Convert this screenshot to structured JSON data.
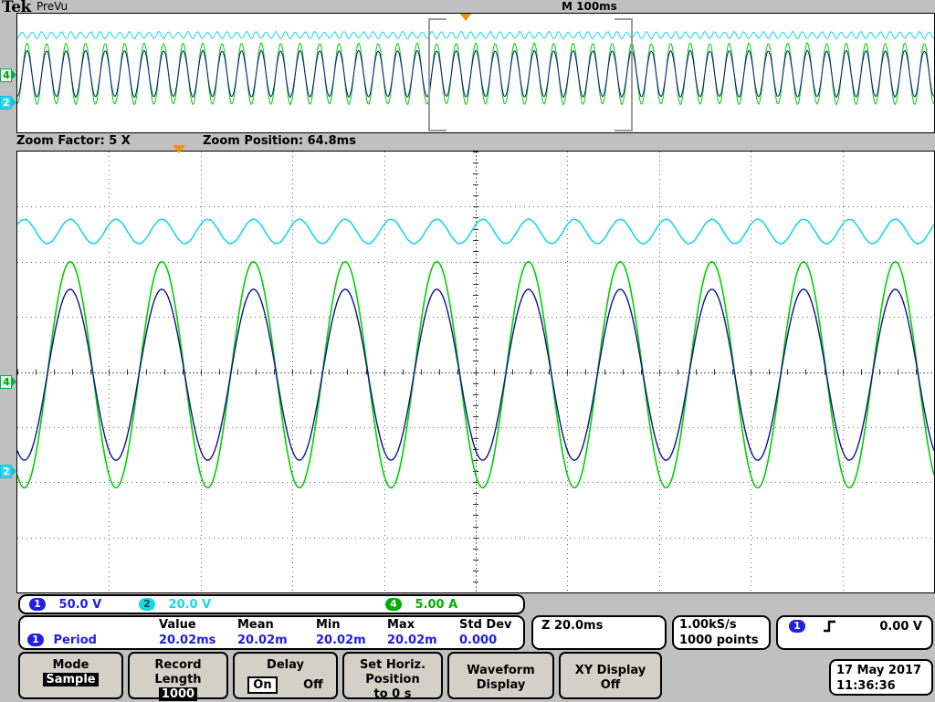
{
  "header": {
    "brand": "Tek",
    "acq_state": "PreVu",
    "horizontal_scale": "M 100ms"
  },
  "zoom_bar": {
    "factor_label": "Zoom Factor: 5 X",
    "position_label": "Zoom Position: 64.8ms"
  },
  "channels": [
    {
      "num": "1",
      "scale": "50.0 V",
      "color": "#2020e0"
    },
    {
      "num": "2",
      "scale": "20.0 V",
      "color": "#18d8e8"
    },
    {
      "num": "4",
      "scale": "5.00 A",
      "color": "#00b000"
    }
  ],
  "measurement": {
    "source_badge": "1",
    "name": "Period",
    "columns": [
      "Value",
      "Mean",
      "Min",
      "Max",
      "Std Dev"
    ],
    "values": [
      "20.02ms",
      "20.02m",
      "20.02m",
      "20.02m",
      "0.000"
    ]
  },
  "zoom_timebase": "Z 20.0ms",
  "acquisition": {
    "sample_rate": "1.00kS/s",
    "record_points": "1000 points"
  },
  "trigger": {
    "source_badge": "1",
    "slope_icon": "rising-edge-icon",
    "level": "0.00 V"
  },
  "menu_buttons": [
    {
      "name": "mode",
      "line1": "Mode",
      "line2": "Sample",
      "line2_style": "inverse"
    },
    {
      "name": "record-length",
      "line1": "Record",
      "line2": "Length",
      "line3": "1000",
      "line3_style": "inverse"
    },
    {
      "name": "delay",
      "line1": "Delay",
      "opt_on": "On",
      "opt_off": "Off",
      "selected": "On"
    },
    {
      "name": "set-horiz-position",
      "line1": "Set Horiz.",
      "line2": "Position",
      "line3": "to 0 s"
    },
    {
      "name": "waveform-display",
      "line1": "Waveform",
      "line2": "Display"
    },
    {
      "name": "xy-display",
      "line1": "XY Display",
      "line2": "Off"
    }
  ],
  "clock": {
    "date": "17 May 2017",
    "time": "11:36:36"
  },
  "markers": {
    "overview_ch4": "4",
    "overview_ch2": "2",
    "zoom_ch4": "4",
    "zoom_ch2": "2"
  },
  "chart_data": {
    "type": "line",
    "title": "Oscilloscope waveform display",
    "overview": {
      "timebase_per_div": "100ms",
      "x_divisions": 10,
      "y_divisions": 8,
      "series": [
        {
          "name": "CH2",
          "color": "#18d8e8",
          "waveform": "sine",
          "frequency_hz": 50,
          "amplitude_div": 0.22,
          "offset_div": 2.55,
          "scale": "20.0 V"
        },
        {
          "name": "CH4",
          "color": "#00d000",
          "waveform": "sine",
          "frequency_hz": 50,
          "amplitude_div": 2.05,
          "offset_div": -0.05,
          "scale": "5.00 A"
        },
        {
          "name": "CH1",
          "color": "#101090",
          "waveform": "sine",
          "frequency_hz": 50,
          "amplitude_div": 1.55,
          "offset_div": -0.05,
          "scale": "50.0 V"
        }
      ]
    },
    "zoom": {
      "timebase_per_div": "20.0ms",
      "zoom_factor": "5 X",
      "zoom_position_ms": 64.8,
      "x_divisions": 10,
      "y_divisions": 8,
      "cycles_visible": 10,
      "series": [
        {
          "name": "CH2",
          "color": "#18d8e8",
          "waveform": "sine",
          "frequency_hz": 50,
          "amplitude_div": 0.22,
          "offset_div": 2.55,
          "scale": "20.0 V"
        },
        {
          "name": "CH4",
          "color": "#00d000",
          "waveform": "sine",
          "frequency_hz": 50,
          "amplitude_div": 2.05,
          "offset_div": -0.05,
          "scale": "5.00 A"
        },
        {
          "name": "CH1",
          "color": "#101090",
          "waveform": "sine",
          "frequency_hz": 50,
          "amplitude_div": 1.55,
          "offset_div": -0.05,
          "scale": "50.0 V"
        }
      ]
    }
  }
}
